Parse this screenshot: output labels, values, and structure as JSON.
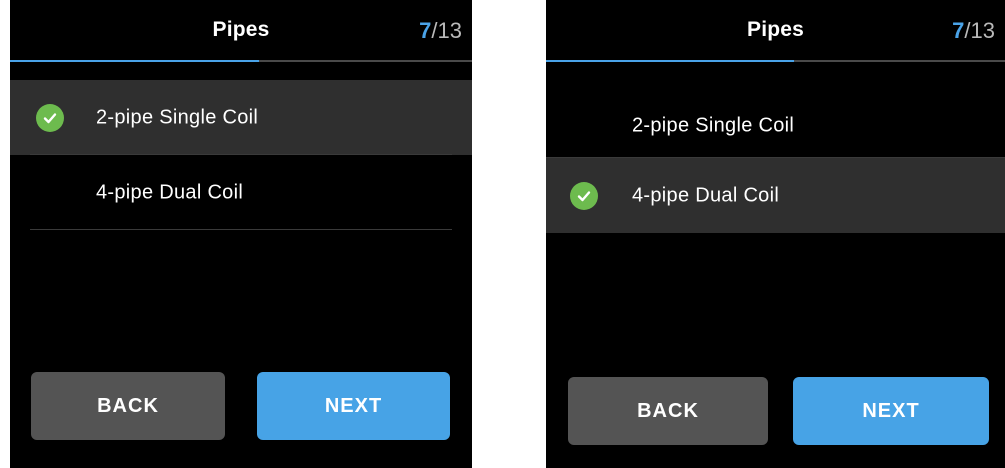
{
  "screens": [
    {
      "header": {
        "title": "Pipes",
        "page_current": "7",
        "page_total": "/13"
      },
      "progress": 0.54,
      "options": [
        {
          "label": "2-pipe Single Coil",
          "selected": true
        },
        {
          "label": "4-pipe Dual Coil",
          "selected": false
        }
      ],
      "buttons": {
        "back": "BACK",
        "next": "NEXT"
      }
    },
    {
      "header": {
        "title": "Pipes",
        "page_current": "7",
        "page_total": "/13"
      },
      "progress": 0.54,
      "options": [
        {
          "label": "2-pipe Single Coil",
          "selected": false
        },
        {
          "label": "4-pipe Dual Coil",
          "selected": true
        }
      ],
      "buttons": {
        "back": "BACK",
        "next": "NEXT"
      }
    }
  ],
  "colors": {
    "accent": "#4aa3e8",
    "check_green": "#6dbb4e",
    "selected_row": "#2f2f2f",
    "back_button": "#545454",
    "next_button": "#47a3e6"
  },
  "icons": {
    "selected_marker": "check-circle-icon"
  }
}
